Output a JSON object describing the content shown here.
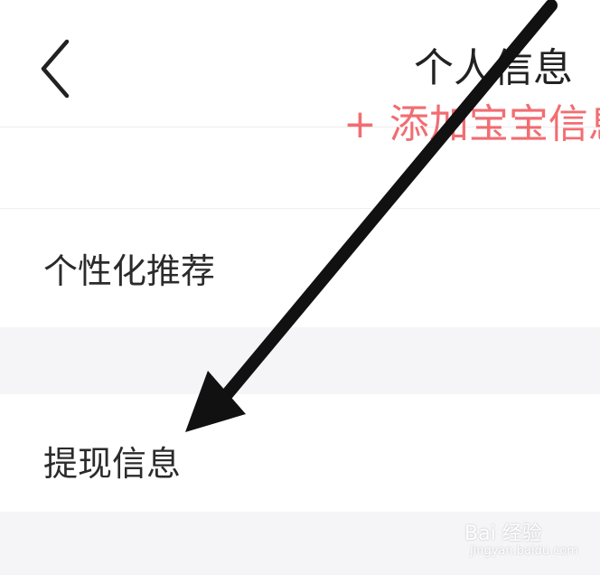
{
  "header": {
    "title": "个人信息",
    "back_icon": "chevron-left-icon"
  },
  "partial_row": {
    "text": "+ 添加宝宝信息",
    "color": "#f0545a"
  },
  "rows": [
    {
      "label": "个性化推荐"
    },
    {
      "label": "提现信息"
    }
  ],
  "colors": {
    "background": "#ffffff",
    "section_gap": "#f5f5f8",
    "text": "#222222"
  },
  "overlay": {
    "annotation_icon": "arrow-pointer-icon"
  },
  "watermark": {
    "main": "Bai 经验",
    "sub": "jingyan.baidu.com"
  }
}
